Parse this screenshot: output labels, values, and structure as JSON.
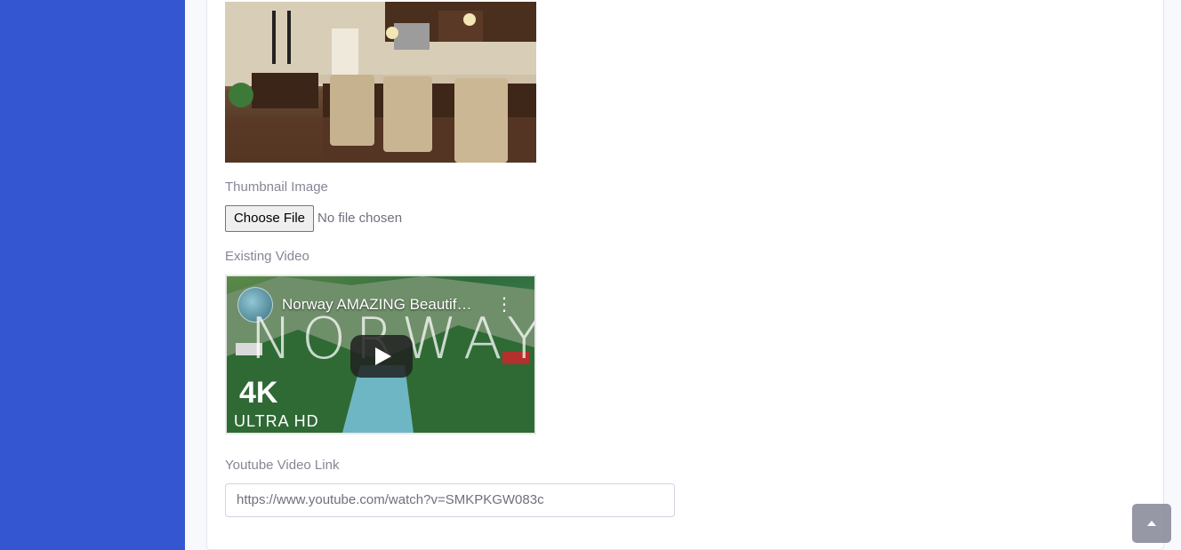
{
  "form": {
    "thumbnail_label": "Thumbnail Image",
    "file_button_label": "Choose File",
    "file_status": "No file chosen",
    "existing_video_label": "Existing Video",
    "youtube_label": "Youtube Video Link",
    "youtube_value": "https://www.youtube.com/watch?v=SMKPKGW083c"
  },
  "video": {
    "title": "Norway AMAZING Beautif…",
    "overlay_word": "NORWAY",
    "badge_4k": "4K",
    "badge_uhd": "ULTRA HD"
  },
  "colors": {
    "sidebar": "#3456d1",
    "label": "#858796",
    "scroll_top_button": "#858796"
  },
  "icons": {
    "play": "play-icon",
    "more": "more-vertical-icon",
    "scroll_top": "chevron-up-icon"
  }
}
